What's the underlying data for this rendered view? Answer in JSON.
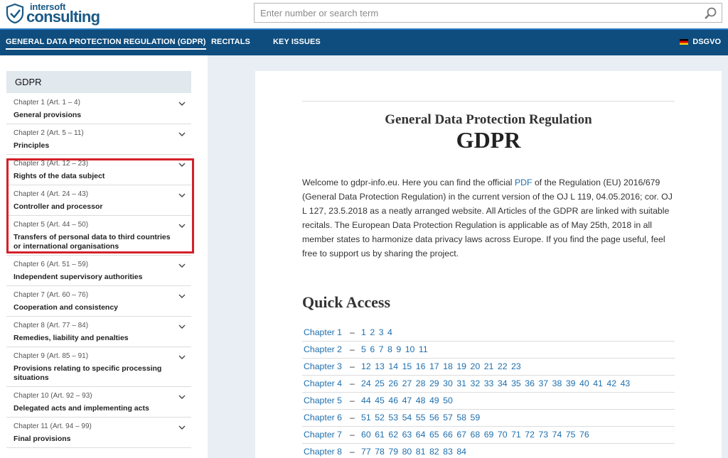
{
  "header": {
    "logo_small": "intersoft",
    "logo_big": "consulting",
    "search_placeholder": "Enter number or search term"
  },
  "nav": {
    "items": [
      "GENERAL DATA PROTECTION REGULATION (GDPR)",
      "RECITALS",
      "KEY ISSUES"
    ],
    "lang_label": "DSGVO"
  },
  "sidebar": {
    "heading": "GDPR",
    "chapters": [
      {
        "sub": "Chapter 1 (Art. 1 – 4)",
        "title": "General provisions"
      },
      {
        "sub": "Chapter 2 (Art. 5 – 11)",
        "title": "Principles"
      },
      {
        "sub": "Chapter 3 (Art. 12 – 23)",
        "title": "Rights of the data subject"
      },
      {
        "sub": "Chapter 4 (Art. 24 – 43)",
        "title": "Controller and processor"
      },
      {
        "sub": "Chapter 5 (Art. 44 – 50)",
        "title": "Transfers of personal data to third countries or international organisations"
      },
      {
        "sub": "Chapter 6 (Art. 51 – 59)",
        "title": "Independent supervisory authorities"
      },
      {
        "sub": "Chapter 7 (Art. 60 – 76)",
        "title": "Cooperation and consistency"
      },
      {
        "sub": "Chapter 8 (Art. 77 – 84)",
        "title": "Remedies, liability and penalties"
      },
      {
        "sub": "Chapter 9 (Art. 85 – 91)",
        "title": "Provisions relating to specific processing situations"
      },
      {
        "sub": "Chapter 10 (Art. 92 – 93)",
        "title": "Delegated acts and implementing acts"
      },
      {
        "sub": "Chapter 11 (Art. 94 – 99)",
        "title": "Final provisions"
      }
    ],
    "highlight_color": "#d3202a"
  },
  "main": {
    "subtitle": "General Data Protection Regulation",
    "title": "GDPR",
    "intro_before_link": "Welcome to gdpr-info.eu. Here you can find the official ",
    "intro_link": "PDF",
    "intro_after_link": " of the Regulation (EU) 2016/679 (General Data Protection Regulation) in the current version of the OJ L 119, 04.05.2016; cor. OJ L 127, 23.5.2018 as a neatly arranged website. All Articles of the GDPR are linked with suitable recitals. The European Data Protection Regulation is applicable as of May 25th, 2018 in all member states to harmonize data privacy laws across Europe. If you find the page useful, feel free to support us by sharing the project.",
    "quick_access_title": "Quick Access",
    "quick_access": [
      {
        "label": "Chapter 1",
        "articles": [
          "1",
          "2",
          "3",
          "4"
        ]
      },
      {
        "label": "Chapter 2",
        "articles": [
          "5",
          "6",
          "7",
          "8",
          "9",
          "10",
          "11"
        ]
      },
      {
        "label": "Chapter 3",
        "articles": [
          "12",
          "13",
          "14",
          "15",
          "16",
          "17",
          "18",
          "19",
          "20",
          "21",
          "22",
          "23"
        ]
      },
      {
        "label": "Chapter 4",
        "articles": [
          "24",
          "25",
          "26",
          "27",
          "28",
          "29",
          "30",
          "31",
          "32",
          "33",
          "34",
          "35",
          "36",
          "37",
          "38",
          "39",
          "40",
          "41",
          "42",
          "43"
        ]
      },
      {
        "label": "Chapter 5",
        "articles": [
          "44",
          "45",
          "46",
          "47",
          "48",
          "49",
          "50"
        ]
      },
      {
        "label": "Chapter 6",
        "articles": [
          "51",
          "52",
          "53",
          "54",
          "55",
          "56",
          "57",
          "58",
          "59"
        ]
      },
      {
        "label": "Chapter 7",
        "articles": [
          "60",
          "61",
          "62",
          "63",
          "64",
          "65",
          "66",
          "67",
          "68",
          "69",
          "70",
          "71",
          "72",
          "73",
          "74",
          "75",
          "76"
        ]
      },
      {
        "label": "Chapter 8",
        "articles": [
          "77",
          "78",
          "79",
          "80",
          "81",
          "82",
          "83",
          "84"
        ]
      }
    ],
    "dash": "–"
  },
  "colors": {
    "nav_bg": "#0e4d7e",
    "link": "#1f6fad",
    "page_bg": "#e8eef3"
  }
}
